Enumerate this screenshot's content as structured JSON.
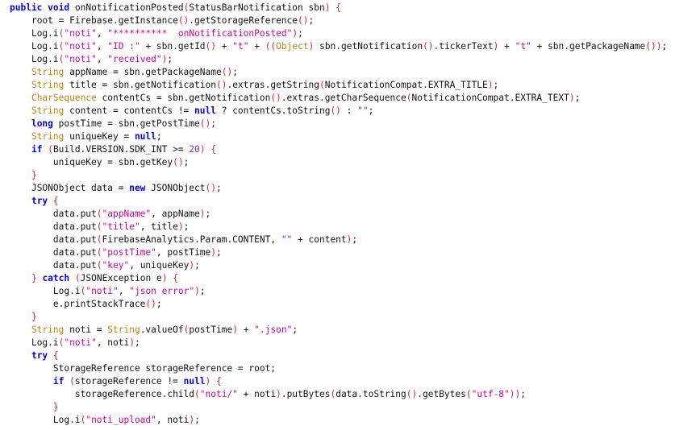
{
  "editor": {
    "language": "java",
    "lines": [
      {
        "indent": 0,
        "tokens": [
          [
            "kw",
            "public"
          ],
          [
            "pl",
            " "
          ],
          [
            "kw",
            "void"
          ],
          [
            "pl",
            " onNotificationPosted"
          ],
          [
            "pa",
            "("
          ],
          [
            "pl",
            "StatusBarNotification sbn"
          ],
          [
            "pa",
            ")"
          ],
          [
            "pl",
            " "
          ],
          [
            "pa",
            "{"
          ]
        ]
      },
      {
        "indent": 1,
        "tokens": [
          [
            "pl",
            "root = Firebase.getInstance"
          ],
          [
            "pa",
            "()"
          ],
          [
            "pl",
            ".getStorageReference"
          ],
          [
            "pa",
            "()"
          ],
          [
            "pl",
            ";"
          ]
        ]
      },
      {
        "indent": 1,
        "tokens": [
          [
            "pl",
            "Log.i"
          ],
          [
            "pa",
            "("
          ],
          [
            "st",
            "\"noti\""
          ],
          [
            "pl",
            ", "
          ],
          [
            "st",
            "\"**********  onNotificationPosted\""
          ],
          [
            "pa",
            ")"
          ],
          [
            "pl",
            ";"
          ]
        ]
      },
      {
        "indent": 1,
        "tokens": [
          [
            "pl",
            "Log.i"
          ],
          [
            "pa",
            "("
          ],
          [
            "st",
            "\"noti\""
          ],
          [
            "pl",
            ", "
          ],
          [
            "st",
            "\"ID :\""
          ],
          [
            "pl",
            " + sbn.getId"
          ],
          [
            "pa",
            "()"
          ],
          [
            "pl",
            " + "
          ],
          [
            "st",
            "\"t\""
          ],
          [
            "pl",
            " + "
          ],
          [
            "pa",
            "(("
          ],
          [
            "ty",
            "Object"
          ],
          [
            "pa",
            ")"
          ],
          [
            "pl",
            " sbn.getNotification"
          ],
          [
            "pa",
            "()"
          ],
          [
            "pl",
            ".tickerText"
          ],
          [
            "pa",
            ")"
          ],
          [
            "pl",
            " + "
          ],
          [
            "st",
            "\"t\""
          ],
          [
            "pl",
            " + sbn.getPackageName"
          ],
          [
            "pa",
            "())"
          ],
          [
            "pl",
            ";"
          ]
        ]
      },
      {
        "indent": 1,
        "tokens": [
          [
            "pl",
            "Log.i"
          ],
          [
            "pa",
            "("
          ],
          [
            "st",
            "\"noti\""
          ],
          [
            "pl",
            ", "
          ],
          [
            "st",
            "\"received\""
          ],
          [
            "pa",
            ")"
          ],
          [
            "pl",
            ";"
          ]
        ]
      },
      {
        "indent": 1,
        "tokens": [
          [
            "ty",
            "String"
          ],
          [
            "pl",
            " appName = sbn.getPackageName"
          ],
          [
            "pa",
            "()"
          ],
          [
            "pl",
            ";"
          ]
        ]
      },
      {
        "indent": 1,
        "tokens": [
          [
            "ty",
            "String"
          ],
          [
            "pl",
            " title = sbn.getNotification"
          ],
          [
            "pa",
            "()"
          ],
          [
            "pl",
            ".extras.getString"
          ],
          [
            "pa",
            "("
          ],
          [
            "pl",
            "NotificationCompat.EXTRA_TITLE"
          ],
          [
            "pa",
            ")"
          ],
          [
            "pl",
            ";"
          ]
        ]
      },
      {
        "indent": 1,
        "tokens": [
          [
            "ty",
            "CharSequence"
          ],
          [
            "pl",
            " contentCs = sbn.getNotification"
          ],
          [
            "pa",
            "()"
          ],
          [
            "pl",
            ".extras.getCharSequence"
          ],
          [
            "pa",
            "("
          ],
          [
            "pl",
            "NotificationCompat.EXTRA_TEXT"
          ],
          [
            "pa",
            ")"
          ],
          [
            "pl",
            ";"
          ]
        ]
      },
      {
        "indent": 1,
        "tokens": [
          [
            "ty",
            "String"
          ],
          [
            "pl",
            " content = contentCs != "
          ],
          [
            "kw",
            "null"
          ],
          [
            "pl",
            " ? contentCs.toString"
          ],
          [
            "pa",
            "()"
          ],
          [
            "pl",
            " : "
          ],
          [
            "st",
            "\"\""
          ],
          [
            "pl",
            ";"
          ]
        ]
      },
      {
        "indent": 1,
        "tokens": [
          [
            "kw",
            "long"
          ],
          [
            "pl",
            " postTime = sbn.getPostTime"
          ],
          [
            "pa",
            "()"
          ],
          [
            "pl",
            ";"
          ]
        ]
      },
      {
        "indent": 1,
        "tokens": [
          [
            "ty",
            "String"
          ],
          [
            "pl",
            " uniqueKey = "
          ],
          [
            "kw",
            "null"
          ],
          [
            "pl",
            ";"
          ]
        ]
      },
      {
        "indent": 1,
        "tokens": [
          [
            "kw",
            "if"
          ],
          [
            "pl",
            " "
          ],
          [
            "pa",
            "("
          ],
          [
            "pl",
            "Build.VERSION.SDK_INT >= "
          ],
          [
            "nu",
            "20"
          ],
          [
            "pa",
            ")"
          ],
          [
            "pl",
            " "
          ],
          [
            "pa",
            "{"
          ]
        ]
      },
      {
        "indent": 2,
        "tokens": [
          [
            "pl",
            "uniqueKey = sbn.getKey"
          ],
          [
            "pa",
            "()"
          ],
          [
            "pl",
            ";"
          ]
        ]
      },
      {
        "indent": 1,
        "tokens": [
          [
            "pa",
            "}"
          ]
        ]
      },
      {
        "indent": 1,
        "tokens": [
          [
            "pl",
            "JSONObject data = "
          ],
          [
            "kw",
            "new"
          ],
          [
            "pl",
            " JSONObject"
          ],
          [
            "pa",
            "()"
          ],
          [
            "pl",
            ";"
          ]
        ]
      },
      {
        "indent": 1,
        "tokens": [
          [
            "kw",
            "try"
          ],
          [
            "pl",
            " "
          ],
          [
            "pa",
            "{"
          ]
        ]
      },
      {
        "indent": 2,
        "tokens": [
          [
            "pl",
            "data.put"
          ],
          [
            "pa",
            "("
          ],
          [
            "st",
            "\"appName\""
          ],
          [
            "pl",
            ", appName"
          ],
          [
            "pa",
            ")"
          ],
          [
            "pl",
            ";"
          ]
        ]
      },
      {
        "indent": 2,
        "tokens": [
          [
            "pl",
            "data.put"
          ],
          [
            "pa",
            "("
          ],
          [
            "st",
            "\"title\""
          ],
          [
            "pl",
            ", title"
          ],
          [
            "pa",
            ")"
          ],
          [
            "pl",
            ";"
          ]
        ]
      },
      {
        "indent": 2,
        "tokens": [
          [
            "pl",
            "data.put"
          ],
          [
            "pa",
            "("
          ],
          [
            "pl",
            "FirebaseAnalytics.Param.CONTENT, "
          ],
          [
            "st",
            "\"\""
          ],
          [
            "pl",
            " + content"
          ],
          [
            "pa",
            ")"
          ],
          [
            "pl",
            ";"
          ]
        ]
      },
      {
        "indent": 2,
        "tokens": [
          [
            "pl",
            "data.put"
          ],
          [
            "pa",
            "("
          ],
          [
            "st",
            "\"postTime\""
          ],
          [
            "pl",
            ", postTime"
          ],
          [
            "pa",
            ")"
          ],
          [
            "pl",
            ";"
          ]
        ]
      },
      {
        "indent": 2,
        "tokens": [
          [
            "pl",
            "data.put"
          ],
          [
            "pa",
            "("
          ],
          [
            "st",
            "\"key\""
          ],
          [
            "pl",
            ", uniqueKey"
          ],
          [
            "pa",
            ")"
          ],
          [
            "pl",
            ";"
          ]
        ]
      },
      {
        "indent": 1,
        "tokens": [
          [
            "pa",
            "}"
          ],
          [
            "pl",
            " "
          ],
          [
            "kw",
            "catch"
          ],
          [
            "pl",
            " "
          ],
          [
            "pa",
            "("
          ],
          [
            "pl",
            "JSONException e"
          ],
          [
            "pa",
            ")"
          ],
          [
            "pl",
            " "
          ],
          [
            "pa",
            "{"
          ]
        ]
      },
      {
        "indent": 2,
        "tokens": [
          [
            "pl",
            "Log.i"
          ],
          [
            "pa",
            "("
          ],
          [
            "st",
            "\"noti\""
          ],
          [
            "pl",
            ", "
          ],
          [
            "st",
            "\"json error\""
          ],
          [
            "pa",
            ")"
          ],
          [
            "pl",
            ";"
          ]
        ]
      },
      {
        "indent": 2,
        "tokens": [
          [
            "pl",
            "e.printStackTrace"
          ],
          [
            "pa",
            "()"
          ],
          [
            "pl",
            ";"
          ]
        ]
      },
      {
        "indent": 1,
        "tokens": [
          [
            "pa",
            "}"
          ]
        ]
      },
      {
        "indent": 1,
        "tokens": [
          [
            "ty",
            "String"
          ],
          [
            "pl",
            " noti = "
          ],
          [
            "ty",
            "String"
          ],
          [
            "pl",
            ".valueOf"
          ],
          [
            "pa",
            "("
          ],
          [
            "pl",
            "postTime"
          ],
          [
            "pa",
            ")"
          ],
          [
            "pl",
            " + "
          ],
          [
            "st",
            "\".json\""
          ],
          [
            "pl",
            ";"
          ]
        ]
      },
      {
        "indent": 1,
        "tokens": [
          [
            "pl",
            "Log.i"
          ],
          [
            "pa",
            "("
          ],
          [
            "st",
            "\"noti\""
          ],
          [
            "pl",
            ", noti"
          ],
          [
            "pa",
            ")"
          ],
          [
            "pl",
            ";"
          ]
        ]
      },
      {
        "indent": 1,
        "tokens": [
          [
            "kw",
            "try"
          ],
          [
            "pl",
            " "
          ],
          [
            "pa",
            "{"
          ]
        ]
      },
      {
        "indent": 2,
        "tokens": [
          [
            "pl",
            "StorageReference storageReference = root;"
          ]
        ]
      },
      {
        "indent": 2,
        "tokens": [
          [
            "kw",
            "if"
          ],
          [
            "pl",
            " "
          ],
          [
            "pa",
            "("
          ],
          [
            "pl",
            "storageReference != "
          ],
          [
            "kw",
            "null"
          ],
          [
            "pa",
            ")"
          ],
          [
            "pl",
            " "
          ],
          [
            "pa",
            "{"
          ]
        ]
      },
      {
        "indent": 3,
        "tokens": [
          [
            "pl",
            "storageReference.child"
          ],
          [
            "pa",
            "("
          ],
          [
            "st",
            "\"noti/\""
          ],
          [
            "pl",
            " + noti"
          ],
          [
            "pa",
            ")"
          ],
          [
            "pl",
            ".putBytes"
          ],
          [
            "pa",
            "("
          ],
          [
            "pl",
            "data.toString"
          ],
          [
            "pa",
            "()"
          ],
          [
            "pl",
            ".getBytes"
          ],
          [
            "pa",
            "("
          ],
          [
            "st",
            "\"utf-8\""
          ],
          [
            "pa",
            "))"
          ],
          [
            "pl",
            ";"
          ]
        ]
      },
      {
        "indent": 2,
        "tokens": [
          [
            "pa",
            "}"
          ]
        ]
      },
      {
        "indent": 2,
        "tokens": [
          [
            "pl",
            "Log.i"
          ],
          [
            "pa",
            "("
          ],
          [
            "st",
            "\"noti_upload\""
          ],
          [
            "pl",
            ", noti"
          ],
          [
            "pa",
            ")"
          ],
          [
            "pl",
            ";"
          ]
        ]
      }
    ]
  }
}
